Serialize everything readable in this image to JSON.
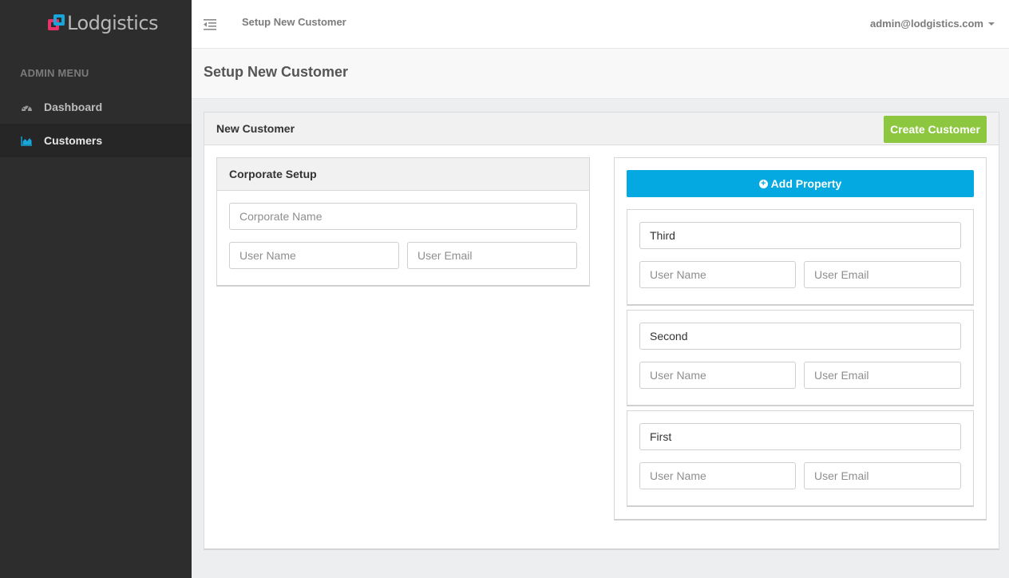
{
  "brand": {
    "name": "Lodgistics"
  },
  "sidebar": {
    "heading": "ADMIN MENU",
    "items": [
      {
        "label": "Dashboard",
        "icon": "dashboard-icon",
        "active": false
      },
      {
        "label": "Customers",
        "icon": "chart-icon",
        "active": true
      }
    ]
  },
  "topbar": {
    "title": "Setup New Customer",
    "user": "admin@lodgistics.com"
  },
  "page": {
    "title": "Setup New Customer"
  },
  "panel": {
    "title": "New Customer",
    "create_label": "Create Customer"
  },
  "corporate": {
    "title": "Corporate Setup",
    "name_placeholder": "Corporate Name",
    "user_name_placeholder": "User Name",
    "user_email_placeholder": "User Email"
  },
  "properties": {
    "add_label": "Add Property",
    "items": [
      {
        "name": "Third",
        "user_name_placeholder": "User Name",
        "user_email_placeholder": "User Email"
      },
      {
        "name": "Second",
        "user_name_placeholder": "User Name",
        "user_email_placeholder": "User Email"
      },
      {
        "name": "First",
        "user_name_placeholder": "User Name",
        "user_email_placeholder": "User Email"
      }
    ]
  },
  "colors": {
    "sidebar_bg": "#2d2d2d",
    "create_button": "#8dc63f",
    "add_button": "#03a9e0",
    "logo_pink": "#e8336a",
    "logo_blue": "#16a6dc"
  }
}
